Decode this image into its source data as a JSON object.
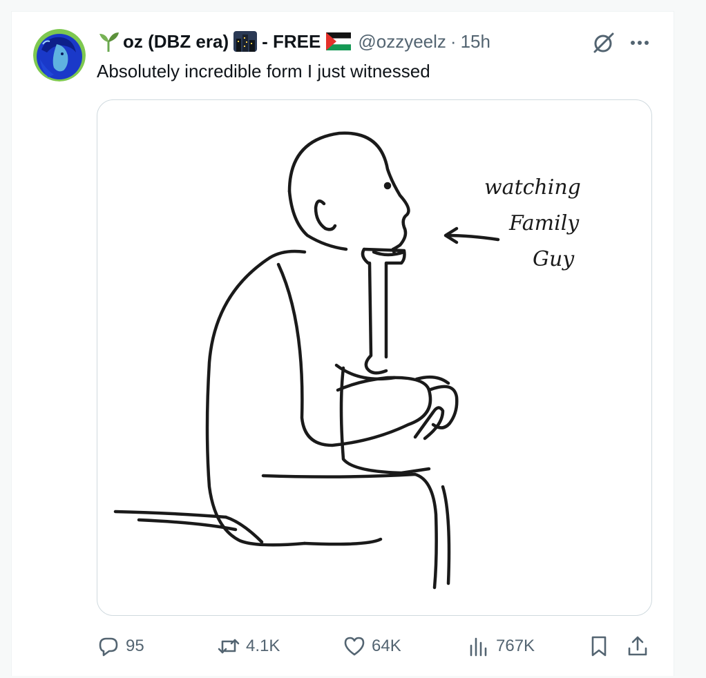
{
  "author": {
    "display_name": "oz (DBZ era)",
    "name_suffix": "- FREE",
    "handle": "@ozzyeelz",
    "separator": "·",
    "time": "15h"
  },
  "tweet": {
    "text": "Absolutely incredible form I just witnessed"
  },
  "media": {
    "handwritten_label": [
      "watching",
      "Family",
      "Guy"
    ]
  },
  "actions": {
    "replies": "95",
    "reposts": "4.1K",
    "likes": "64K",
    "views": "767K"
  },
  "icons": {
    "avatar": "avatar-image",
    "sprout": "seedling-emoji",
    "night_city": "night-city-emoji",
    "flag": "palestine-flag-emoji",
    "grok": "grok-icon",
    "more": "more-dots-icon",
    "reply": "reply-icon",
    "repost": "repost-icon",
    "like": "heart-icon",
    "views": "views-chart-icon",
    "bookmark": "bookmark-icon",
    "share": "share-icon"
  },
  "colors": {
    "text": "#0f1419",
    "muted": "#536471",
    "border": "#cfd9de"
  }
}
